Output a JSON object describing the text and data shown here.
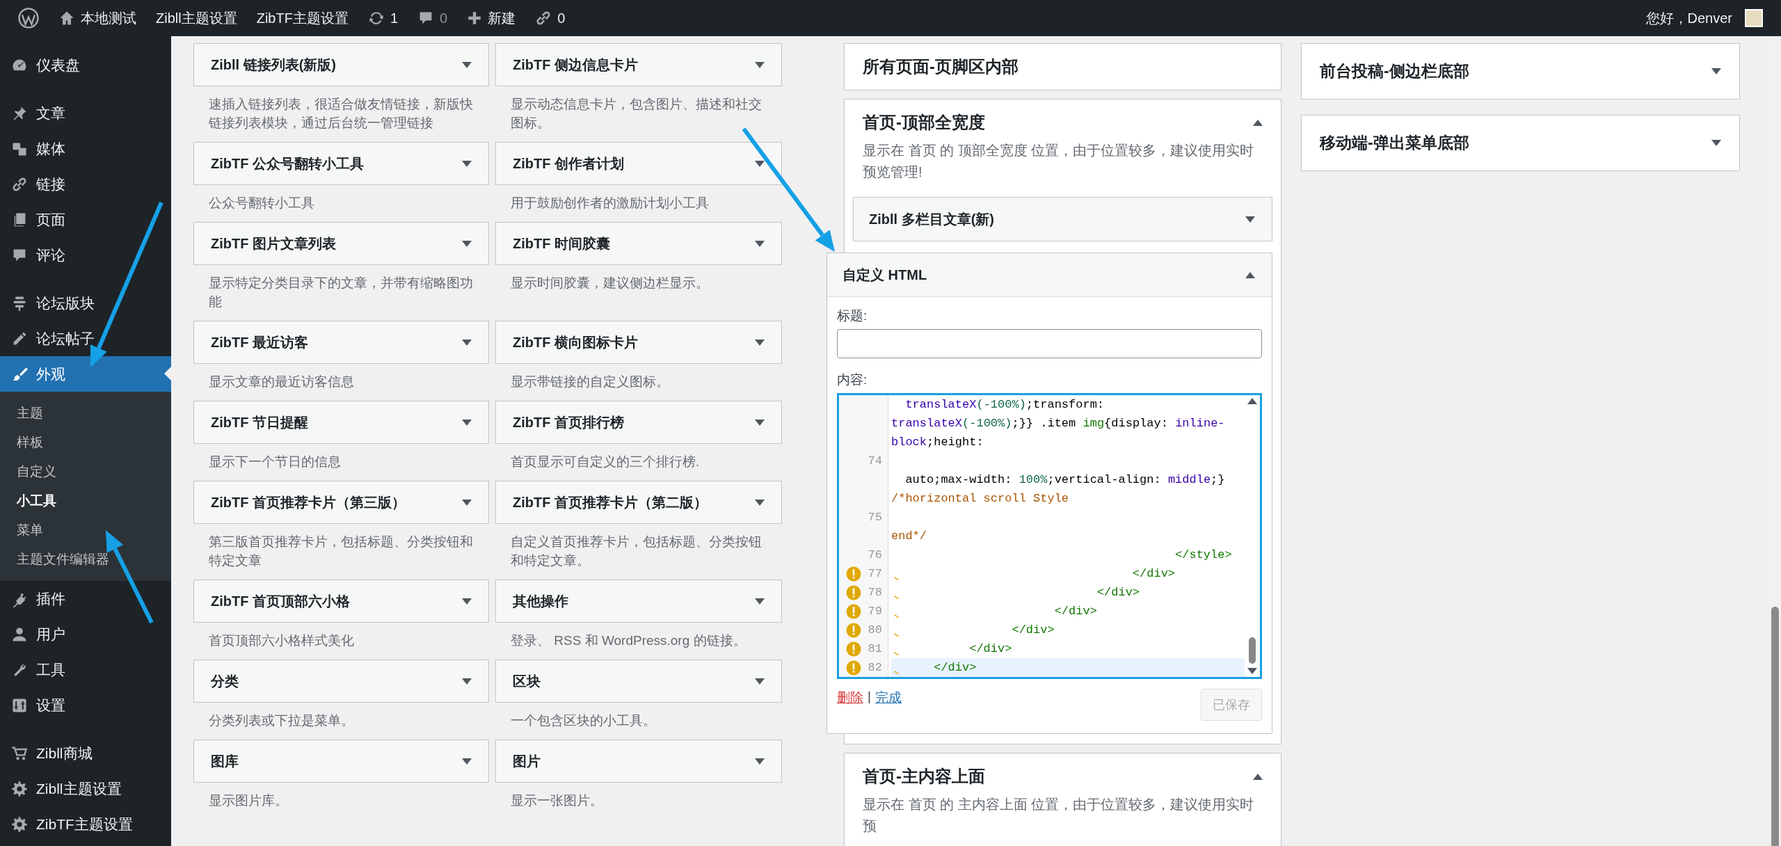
{
  "admin_bar": {
    "site": "本地测试",
    "links": [
      "Zibll主题设置",
      "ZibTF主题设置"
    ],
    "updates": "1",
    "comments": "0",
    "new": "新建",
    "link_count": "0",
    "greeting": "您好，Denver"
  },
  "sidebar": {
    "groups": [
      {
        "items": [
          {
            "label": "仪表盘",
            "selected": false
          }
        ]
      },
      {
        "items": [
          {
            "label": "文章",
            "selected": false
          },
          {
            "label": "媒体",
            "selected": false
          },
          {
            "label": "链接",
            "selected": false
          },
          {
            "label": "页面",
            "selected": false
          },
          {
            "label": "评论",
            "selected": false
          }
        ]
      },
      {
        "items": [
          {
            "label": "论坛版块",
            "selected": false
          },
          {
            "label": "论坛帖子",
            "selected": false
          },
          {
            "label": "外观",
            "selected": true,
            "children": [
              {
                "label": "主题",
                "selected": false
              },
              {
                "label": "样板",
                "selected": false
              },
              {
                "label": "自定义",
                "selected": false
              },
              {
                "label": "小工具",
                "selected": true
              },
              {
                "label": "菜单",
                "selected": false
              },
              {
                "label": "主题文件编辑器",
                "selected": false
              }
            ]
          },
          {
            "label": "插件",
            "selected": false
          },
          {
            "label": "用户",
            "selected": false
          },
          {
            "label": "工具",
            "selected": false
          },
          {
            "label": "设置",
            "selected": false
          }
        ]
      },
      {
        "items": [
          {
            "label": "Zibll商城",
            "selected": false
          },
          {
            "label": "Zibll主题设置",
            "selected": false
          },
          {
            "label": "ZibTF主题设置",
            "selected": false
          }
        ]
      }
    ]
  },
  "available_widgets": [
    {
      "title": "Zibll 链接列表(新版)",
      "description": "速插入链接列表，很适合做友情链接，新版快链接列表模块，通过后台统一管理链接"
    },
    {
      "title": "ZibTF 侧边信息卡片",
      "description": "显示动态信息卡片，包含图片、描述和社交图标。"
    },
    {
      "title": "ZibTF 公众号翻转小工具",
      "description": "公众号翻转小工具"
    },
    {
      "title": "ZibTF 创作者计划",
      "description": "用于鼓励创作者的激励计划小工具"
    },
    {
      "title": "ZibTF 图片文章列表",
      "description": "显示特定分类目录下的文章，并带有缩略图功能"
    },
    {
      "title": "ZibTF 时间胶囊",
      "description": "显示时间胶囊，建议侧边栏显示。"
    },
    {
      "title": "ZibTF 最近访客",
      "description": "显示文章的最近访客信息"
    },
    {
      "title": "ZibTF 横向图标卡片",
      "description": "显示带链接的自定义图标。"
    },
    {
      "title": "ZibTF 节日提醒",
      "description": "显示下一个节日的信息"
    },
    {
      "title": "ZibTF 首页排行榜",
      "description": "首页显示可自定义的三个排行榜."
    },
    {
      "title": "ZibTF 首页推荐卡片（第三版）",
      "description": "第三版首页推荐卡片，包括标题、分类按钮和特定文章"
    },
    {
      "title": "ZibTF 首页推荐卡片（第二版）",
      "description": "自定义首页推荐卡片，包括标题、分类按钮和特定文章。"
    },
    {
      "title": "ZibTF 首页顶部六小格",
      "description": "首页顶部六小格样式美化"
    },
    {
      "title": "其他操作",
      "description": "登录、 RSS 和 WordPress.org 的链接。"
    },
    {
      "title": "分类",
      "description": "分类列表或下拉是菜单。"
    },
    {
      "title": "区块",
      "description": "一个包含区块的小工具。"
    },
    {
      "title": "图库",
      "description": "显示图片库。"
    },
    {
      "title": "图片",
      "description": "显示一张图片。"
    }
  ],
  "middle_column": {
    "areas": [
      {
        "title": "所有页面-页脚区内部"
      },
      {
        "title": "首页-顶部全宽度",
        "expanded": true,
        "description": "显示在 首页 的 顶部全宽度 位置，由于位置较多，建议使用实时预览管理!",
        "widgets": [
          {
            "title": "Zibll 多栏目文章(新)",
            "expanded": false
          },
          {
            "title": "自定义 HTML",
            "expanded": true,
            "form": {
              "title_label": "标题:",
              "content_label": "内容:",
              "delete": "删除",
              "separator": "|",
              "done": "完成",
              "save": "已保存",
              "save_disabled": true,
              "code_rows": [
                {
                  "segments": [
                    {
                      "kind": "function",
                      "text": "  translateX"
                    },
                    {
                      "kind": "number",
                      "text": "(-100%)"
                    },
                    {
                      "kind": "plain",
                      "text": ";transform:"
                    }
                  ]
                },
                {
                  "segments": [
                    {
                      "kind": "function",
                      "text": "translateX"
                    },
                    {
                      "kind": "number",
                      "text": "(-100%)"
                    },
                    {
                      "kind": "plain",
                      "text": ";}} .item "
                    },
                    {
                      "kind": "tag",
                      "text": "img"
                    },
                    {
                      "kind": "plain",
                      "text": "{display: "
                    },
                    {
                      "kind": "keyword",
                      "text": "inline-"
                    }
                  ]
                },
                {
                  "segments": [
                    {
                      "kind": "keyword",
                      "text": "block"
                    },
                    {
                      "kind": "plain",
                      "text": ";height:"
                    }
                  ]
                },
                {
                  "number": "74"
                },
                {
                  "segments": [
                    {
                      "kind": "plain",
                      "text": "  auto;max-width: "
                    },
                    {
                      "kind": "number",
                      "text": "100%"
                    },
                    {
                      "kind": "plain",
                      "text": ";vertical-align: "
                    },
                    {
                      "kind": "keyword",
                      "text": "middle"
                    },
                    {
                      "kind": "plain",
                      "text": ";}"
                    }
                  ]
                },
                {
                  "segments": [
                    {
                      "kind": "comment",
                      "text": "/*horizontal scroll Style"
                    }
                  ]
                },
                {
                  "number": "75"
                },
                {
                  "segments": [
                    {
                      "kind": "comment",
                      "text": "end*/"
                    }
                  ]
                },
                {
                  "number": "76",
                  "segments": [
                    {
                      "kind": "tag",
                      "text": "                                        </style>"
                    }
                  ]
                },
                {
                  "number": "77",
                  "warning": true,
                  "segments": [
                    {
                      "kind": "tag",
                      "text": "                                  </div>"
                    }
                  ]
                },
                {
                  "number": "78",
                  "warning": true,
                  "segments": [
                    {
                      "kind": "tag",
                      "text": "                             </div>"
                    }
                  ]
                },
                {
                  "number": "79",
                  "warning": true,
                  "segments": [
                    {
                      "kind": "tag",
                      "text": "                       </div>"
                    }
                  ]
                },
                {
                  "number": "80",
                  "warning": true,
                  "segments": [
                    {
                      "kind": "tag",
                      "text": "                 </div>"
                    }
                  ]
                },
                {
                  "number": "81",
                  "warning": true,
                  "segments": [
                    {
                      "kind": "tag",
                      "text": "           </div>"
                    }
                  ]
                },
                {
                  "number": "82",
                  "warning": true,
                  "active": true,
                  "segments": [
                    {
                      "kind": "tag",
                      "text": "      </div>"
                    }
                  ]
                }
              ]
            }
          }
        ]
      },
      {
        "title": "首页-主内容上面",
        "expanded": true,
        "description": "显示在 首页 的 主内容上面 位置，由于位置较多，建议使用实时预"
      }
    ]
  },
  "right_column": {
    "areas": [
      {
        "title": "前台投稿-侧边栏底部",
        "expanded": false
      },
      {
        "title": "移动端-弹出菜单底部",
        "expanded": false
      }
    ]
  }
}
